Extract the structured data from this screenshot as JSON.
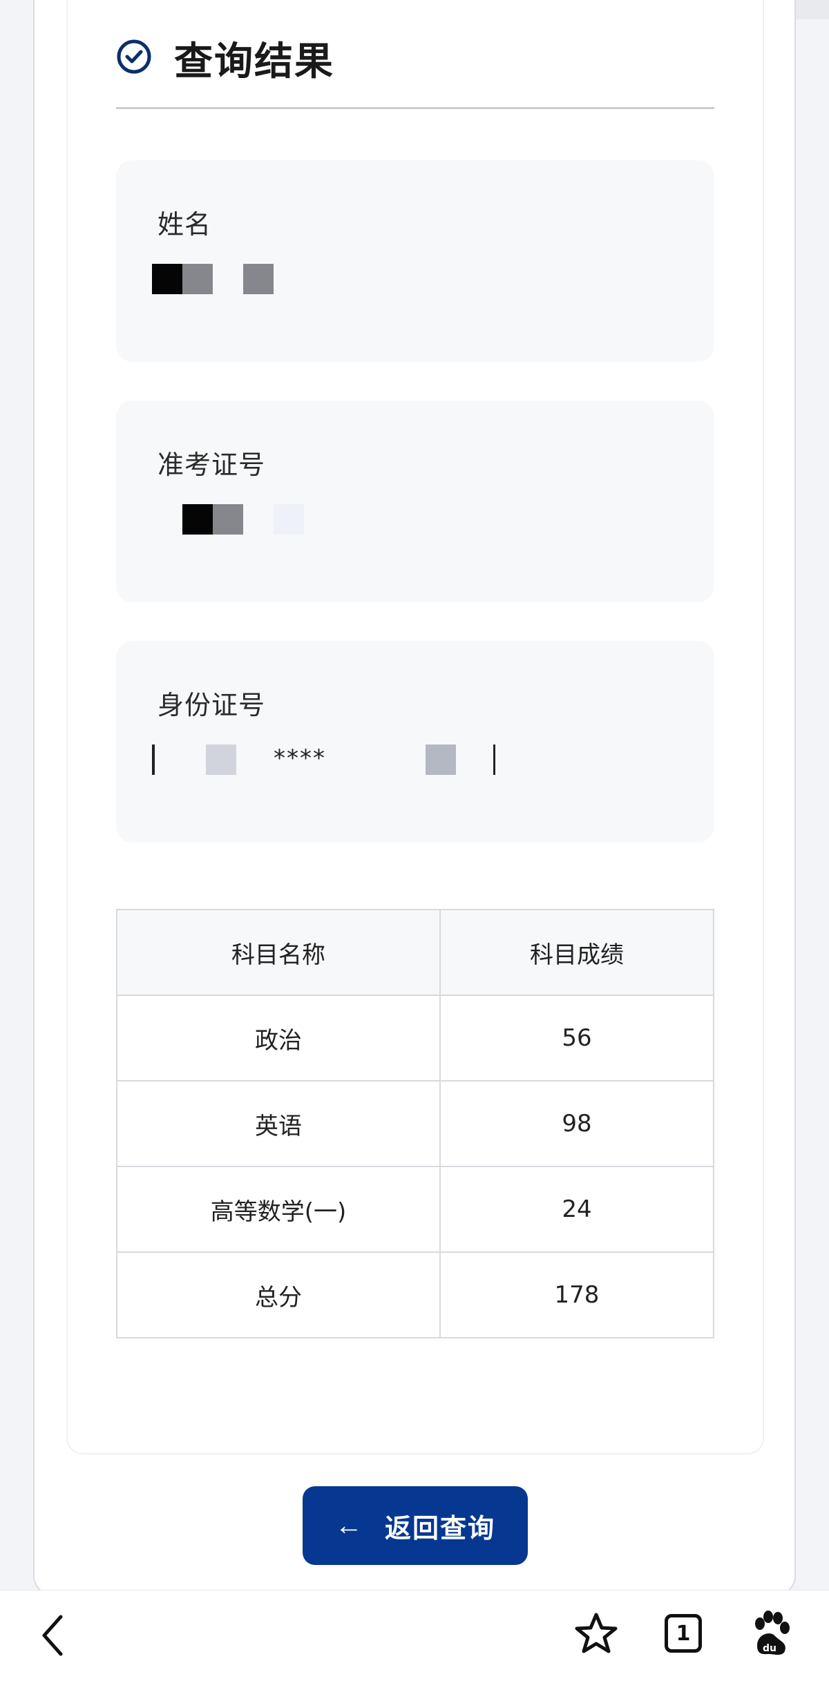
{
  "header": {
    "title": "查询结果",
    "icon": "check-circle-icon"
  },
  "fields": [
    {
      "label": "姓名"
    },
    {
      "label": "准考证号"
    },
    {
      "label": "身份证号",
      "visible_mask": "****"
    }
  ],
  "table": {
    "headers": [
      "科目名称",
      "科目成绩"
    ],
    "rows": [
      {
        "subject": "政治",
        "score": "56"
      },
      {
        "subject": "英语",
        "score": "98"
      },
      {
        "subject": "高等数学(一)",
        "score": "24"
      },
      {
        "subject": "总分",
        "score": "178"
      }
    ]
  },
  "back_button": {
    "label": "返回查询",
    "icon": "arrow-left-icon"
  },
  "bottom_nav": {
    "tab_count": "1",
    "icons": [
      "back-chevron-icon",
      "star-icon",
      "tabs-icon",
      "baidu-paw-icon"
    ]
  },
  "colors": {
    "primary": "#063891",
    "field_bg": "#f7f8fa",
    "border": "#d6d9de"
  }
}
